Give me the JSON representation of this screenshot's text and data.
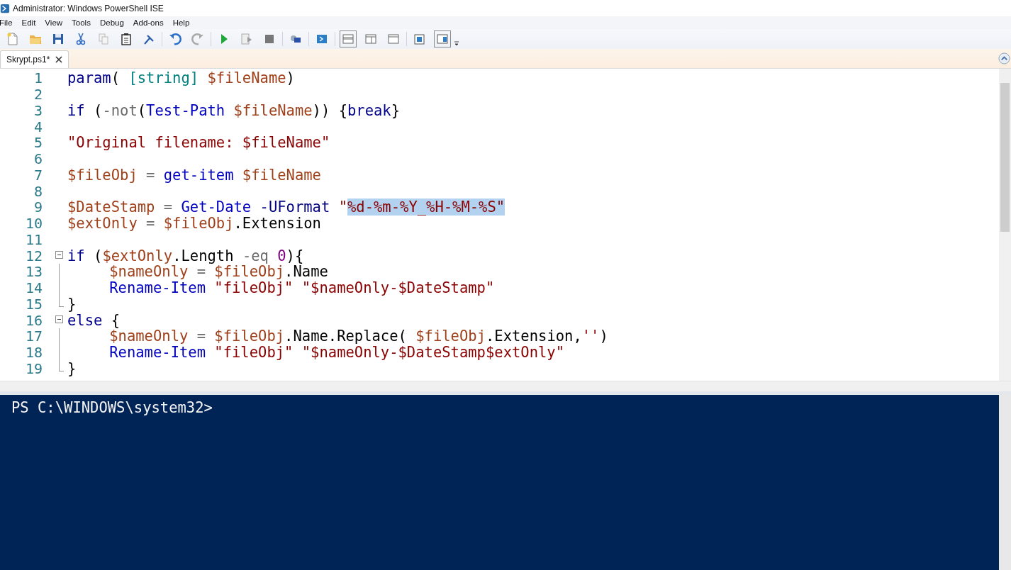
{
  "window": {
    "title": "Administrator: Windows PowerShell ISE"
  },
  "menu": [
    "File",
    "Edit",
    "View",
    "Tools",
    "Debug",
    "Add-ons",
    "Help"
  ],
  "tabs": [
    {
      "label": "Skrypt.ps1*",
      "selected": true
    }
  ],
  "editor": {
    "lines": [
      {
        "number": "1",
        "kind": "plain",
        "tokens": [
          {
            "t": "param",
            "kind": "keyword"
          },
          {
            "t": "( ",
            "kind": "plain"
          },
          {
            "t": "[string]",
            "kind": "type"
          },
          {
            "t": " $fileName",
            "kind": "variable"
          },
          {
            "t": ")",
            "kind": "plain"
          }
        ]
      },
      {
        "number": "2",
        "kind": "plain"
      },
      {
        "number": "3",
        "kind": "plain",
        "tokens": [
          {
            "t": "if",
            "kind": "keyword"
          },
          {
            "t": " (",
            "kind": "plain"
          },
          {
            "t": "-not",
            "kind": "operator"
          },
          {
            "t": "(",
            "kind": "plain"
          },
          {
            "t": "Test-Path",
            "kind": "command"
          },
          {
            "t": " $fileName",
            "kind": "variable"
          },
          {
            "t": ")) {",
            "kind": "plain"
          },
          {
            "t": "break",
            "kind": "keyword"
          },
          {
            "t": "}",
            "kind": "plain"
          }
        ]
      },
      {
        "number": "4",
        "kind": "plain"
      },
      {
        "number": "5",
        "kind": "plain",
        "tokens": [
          {
            "t": "\"Original filename: $fileName\"",
            "kind": "string"
          }
        ]
      },
      {
        "number": "6",
        "kind": "plain"
      },
      {
        "number": "7",
        "kind": "plain",
        "tokens": [
          {
            "t": "$fileObj",
            "kind": "variable"
          },
          {
            "t": " = ",
            "kind": "operator"
          },
          {
            "t": "get-item",
            "kind": "command"
          },
          {
            "t": " $fileName",
            "kind": "variable"
          }
        ]
      },
      {
        "number": "8",
        "kind": "plain"
      },
      {
        "number": "9",
        "kind": "plain",
        "tokens": [
          {
            "t": "$DateStamp",
            "kind": "variable",
            "selected": false
          },
          {
            "t": " = ",
            "kind": "operator",
            "selected": false
          },
          {
            "t": "Get-Date",
            "kind": "command",
            "selected": false
          },
          {
            "t": " -UFormat",
            "kind": "parameter",
            "selected": false
          },
          {
            "t": " \"",
            "kind": "string",
            "selected": false
          },
          {
            "t": "%d-%m-%Y_%H-%M-%S\"",
            "kind": "string",
            "selected": true
          }
        ]
      },
      {
        "number": "10",
        "kind": "plain",
        "tokens": [
          {
            "t": "$extOnly",
            "kind": "variable"
          },
          {
            "t": " = ",
            "kind": "operator"
          },
          {
            "t": "$fileObj",
            "kind": "variable"
          },
          {
            "t": ".Extension",
            "kind": "plain"
          }
        ]
      },
      {
        "number": "11",
        "kind": "plain"
      },
      {
        "number": "12",
        "kind": "foldstart",
        "tokens": [
          {
            "t": "if",
            "kind": "keyword"
          },
          {
            "t": " (",
            "kind": "plain"
          },
          {
            "t": "$extOnly",
            "kind": "variable"
          },
          {
            "t": ".Length ",
            "kind": "plain"
          },
          {
            "t": "-eq",
            "kind": "operator"
          },
          {
            "t": " 0",
            "kind": "number"
          },
          {
            "t": "){",
            "kind": "plain"
          }
        ]
      },
      {
        "number": "13",
        "kind": "foldbody",
        "indented": true,
        "tokens": [
          {
            "t": "$nameOnly",
            "kind": "variable"
          },
          {
            "t": " = ",
            "kind": "operator"
          },
          {
            "t": "$fileObj",
            "kind": "variable"
          },
          {
            "t": ".Name",
            "kind": "plain"
          }
        ]
      },
      {
        "number": "14",
        "kind": "foldbody",
        "indented": true,
        "tokens": [
          {
            "t": "Rename-Item",
            "kind": "command"
          },
          {
            "t": " \"fileObj\"",
            "kind": "string"
          },
          {
            "t": " \"$nameOnly-$DateStamp\"",
            "kind": "string"
          }
        ]
      },
      {
        "number": "15",
        "kind": "foldend",
        "tokens": [
          {
            "t": "}",
            "kind": "plain"
          }
        ]
      },
      {
        "number": "16",
        "kind": "foldstart",
        "tokens": [
          {
            "t": "else",
            "kind": "keyword"
          },
          {
            "t": " {",
            "kind": "plain"
          }
        ]
      },
      {
        "number": "17",
        "kind": "foldbody",
        "indented": true,
        "tokens": [
          {
            "t": "$nameOnly",
            "kind": "variable"
          },
          {
            "t": " = ",
            "kind": "operator"
          },
          {
            "t": "$fileObj",
            "kind": "variable"
          },
          {
            "t": ".Name.Replace( ",
            "kind": "plain"
          },
          {
            "t": "$fileObj",
            "kind": "variable"
          },
          {
            "t": ".Extension,",
            "kind": "plain"
          },
          {
            "t": "''",
            "kind": "string"
          },
          {
            "t": ")",
            "kind": "plain"
          }
        ]
      },
      {
        "number": "18",
        "kind": "foldbody",
        "indented": true,
        "tokens": [
          {
            "t": "Rename-Item",
            "kind": "command"
          },
          {
            "t": " \"fileObj\"",
            "kind": "string"
          },
          {
            "t": " \"$nameOnly-$DateStamp$extOnly\"",
            "kind": "string"
          }
        ]
      },
      {
        "number": "19",
        "kind": "foldend",
        "tokens": [
          {
            "t": "}",
            "kind": "plain"
          }
        ]
      }
    ]
  },
  "console": {
    "prompt": "PS C:\\WINDOWS\\system32>"
  }
}
